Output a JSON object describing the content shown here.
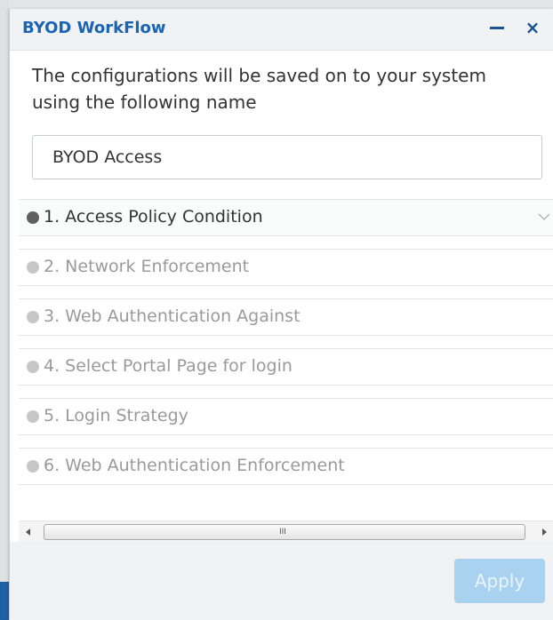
{
  "window": {
    "title": "BYOD WorkFlow",
    "minimize_icon": "minimize-icon",
    "close_icon": "close-icon",
    "close_glyph": "×"
  },
  "description": "The configurations will be saved on to your system using the following name",
  "config_name": {
    "value": "BYOD Access",
    "placeholder": ""
  },
  "steps": [
    {
      "label": "1. Access Policy Condition",
      "state": "active"
    },
    {
      "label": "2. Network Enforcement",
      "state": "disabled"
    },
    {
      "label": "3. Web Authentication Against",
      "state": "disabled"
    },
    {
      "label": "4. Select Portal Page for login",
      "state": "disabled"
    },
    {
      "label": "5. Login Strategy",
      "state": "disabled"
    },
    {
      "label": "6. Web Authentication Enforcement",
      "state": "disabled"
    }
  ],
  "scrollbar": {
    "grip": "III"
  },
  "footer": {
    "apply_label": "Apply",
    "apply_enabled": false
  },
  "colors": {
    "title": "#1a64b4",
    "active_dot": "#5f5f5f",
    "inactive_dot": "#c6c6c6",
    "apply_disabled": "#a9d2f0"
  }
}
